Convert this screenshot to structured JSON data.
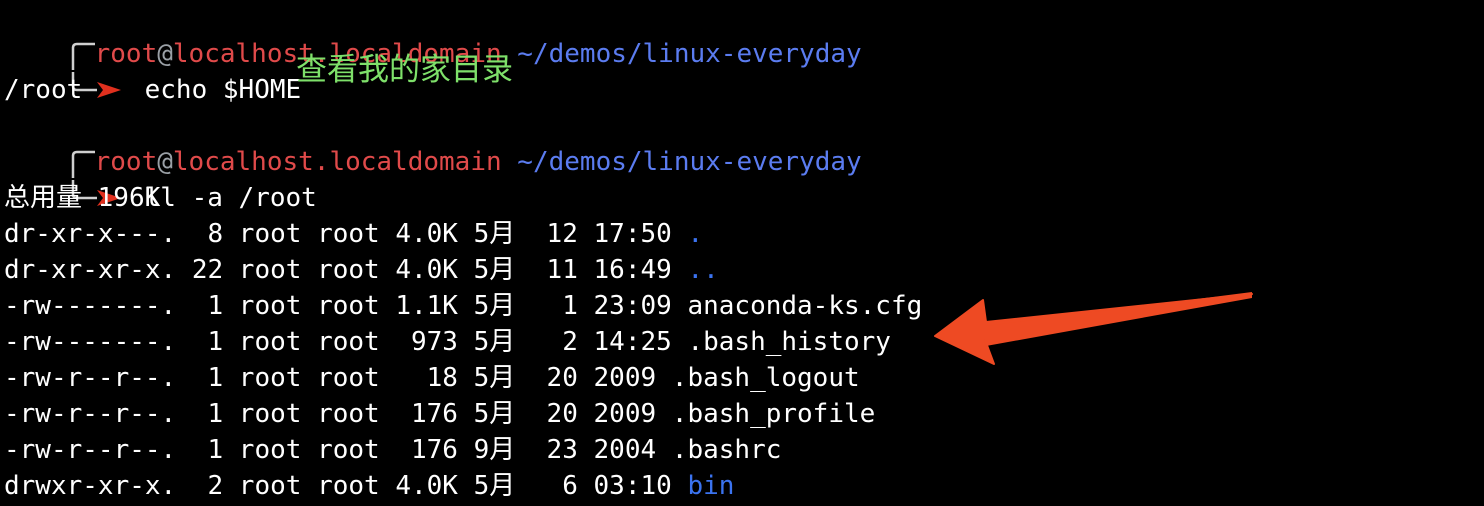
{
  "prompt": {
    "user": "root",
    "at": "@",
    "host": "localhost.localdomain",
    "path": "~/demos/linux-everyday"
  },
  "commands": [
    {
      "text": "echo $HOME"
    },
    {
      "text": "ll -a /root"
    }
  ],
  "echo_output": "/root",
  "annotation": "查看我的家目录",
  "ll_total": "总用量 196K",
  "listing": [
    {
      "perm": "dr-xr-x---.",
      "links": " 8",
      "owner": "root",
      "group": "root",
      "size": "4.0K",
      "month": "5月",
      "day": "12",
      "time": "17:50",
      "name": ".",
      "is_dir": true
    },
    {
      "perm": "dr-xr-xr-x.",
      "links": "22",
      "owner": "root",
      "group": "root",
      "size": "4.0K",
      "month": "5月",
      "day": "11",
      "time": "16:49",
      "name": "..",
      "is_dir": true
    },
    {
      "perm": "-rw-------.",
      "links": " 1",
      "owner": "root",
      "group": "root",
      "size": "1.1K",
      "month": "5月",
      "day": " 1",
      "time": "23:09",
      "name": "anaconda-ks.cfg",
      "is_dir": false
    },
    {
      "perm": "-rw-------.",
      "links": " 1",
      "owner": "root",
      "group": "root",
      "size": " 973",
      "month": "5月",
      "day": " 2",
      "time": "14:25",
      "name": ".bash_history",
      "is_dir": false
    },
    {
      "perm": "-rw-r--r--.",
      "links": " 1",
      "owner": "root",
      "group": "root",
      "size": "  18",
      "month": "5月",
      "day": "20",
      "time": "2009",
      "name": ".bash_logout",
      "is_dir": false
    },
    {
      "perm": "-rw-r--r--.",
      "links": " 1",
      "owner": "root",
      "group": "root",
      "size": " 176",
      "month": "5月",
      "day": "20",
      "time": "2009",
      "name": ".bash_profile",
      "is_dir": false
    },
    {
      "perm": "-rw-r--r--.",
      "links": " 1",
      "owner": "root",
      "group": "root",
      "size": " 176",
      "month": "9月",
      "day": "23",
      "time": "2004",
      "name": ".bashrc",
      "is_dir": false
    },
    {
      "perm": "drwxr-xr-x.",
      "links": " 2",
      "owner": "root",
      "group": "root",
      "size": "4.0K",
      "month": "5月",
      "day": " 6",
      "time": "03:10",
      "name": "bin",
      "is_dir": true
    }
  ],
  "colors": {
    "prompt_user": "#e04a4a",
    "prompt_path": "#5b7cf0",
    "prompt_arrow": "#e0301e",
    "directory": "#3b73f0",
    "annotation": "#7ee06a",
    "callout_arrow": "#ee4a23"
  }
}
